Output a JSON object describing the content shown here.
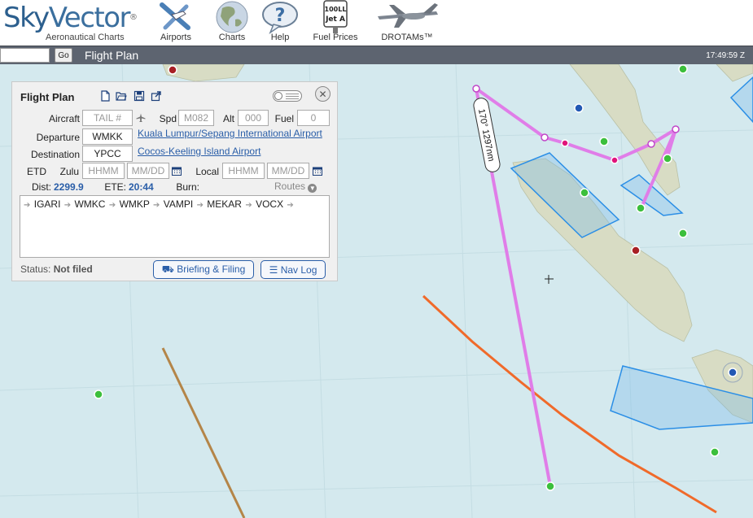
{
  "brand": {
    "name_part1": "Sky",
    "name_part2": "Vector",
    "reg": "®",
    "subtitle": "Aeronautical Charts"
  },
  "nav": [
    {
      "label": "Airports",
      "icon": "airport-icon"
    },
    {
      "label": "Charts",
      "icon": "globe-icon"
    },
    {
      "label": "Help",
      "icon": "help-bubble-icon"
    },
    {
      "label": "Fuel Prices",
      "icon": "fuel-sign-icon"
    },
    {
      "label": "DROTAMs™",
      "icon": "drone-icon"
    }
  ],
  "fuel_sign": {
    "line1": "100LL",
    "line2": "Jet A"
  },
  "toolbar": {
    "search_value": "",
    "go_label": "Go",
    "title": "Flight Plan",
    "clock": "17:49:59 Z"
  },
  "flight_plan": {
    "title": "Flight Plan",
    "aircraft_label": "Aircraft",
    "aircraft_placeholder": "TAIL #",
    "spd_label": "Spd",
    "spd_placeholder": "M082",
    "alt_label": "Alt",
    "alt_placeholder": "000",
    "fuel_label": "Fuel",
    "fuel_placeholder": "0",
    "departure_label": "Departure",
    "departure_value": "WMKK",
    "departure_name": "Kuala Lumpur/Sepang International Airport",
    "destination_label": "Destination",
    "destination_value": "YPCC",
    "destination_name": "Cocos-Keeling Island Airport",
    "etd_label": "ETD",
    "zulu_label": "Zulu",
    "local_label": "Local",
    "time_placeholder": "HHMM",
    "date_placeholder": "MM/DD",
    "dist_label": "Dist:",
    "dist_value": "2299.9",
    "ete_label": "ETE:",
    "ete_value": "20:44",
    "burn_label": "Burn:",
    "routes_label": "Routes",
    "route": [
      "IGARI",
      "WMKC",
      "WMKP",
      "VAMPI",
      "MEKAR",
      "VOCX"
    ],
    "status_label": "Status:",
    "status_value": "Not filed",
    "briefing_label": "Briefing & Filing",
    "navlog_label": "Nav Log"
  },
  "map": {
    "route_leg_label": "170° 1297nm"
  },
  "colors": {
    "route": "#e07de8",
    "route_node": "#e0137a",
    "airspace": "#2a8ee6",
    "ocean": "#d4e9ee",
    "land": "#d8dcc4",
    "boundary_orange": "#f06a2a",
    "boundary_brown": "#b48548"
  }
}
